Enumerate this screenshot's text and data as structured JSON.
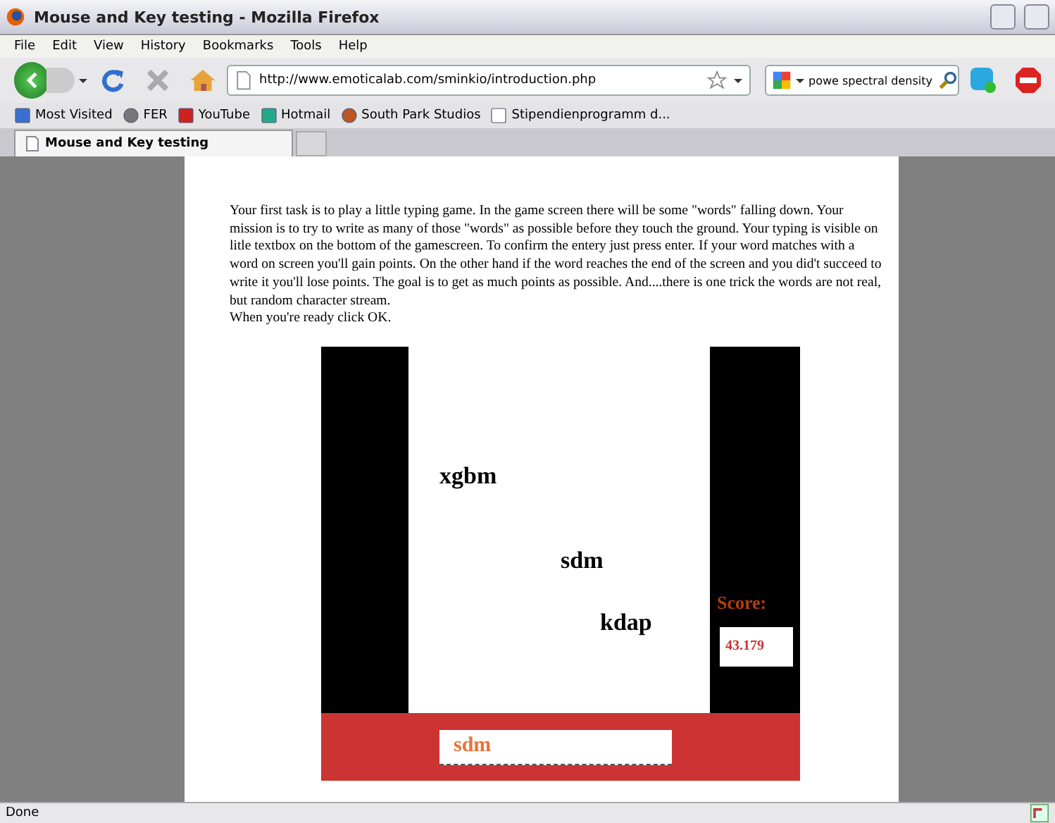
{
  "window": {
    "title": "Mouse and Key testing - Mozilla Firefox"
  },
  "menu": [
    "File",
    "Edit",
    "View",
    "History",
    "Bookmarks",
    "Tools",
    "Help"
  ],
  "navigation": {
    "url": "http://www.emoticalab.com/sminkio/introduction.php",
    "search": "powe spectral density"
  },
  "bookmarks": [
    "Most Visited",
    "FER",
    "YouTube",
    "Hotmail",
    "South Park Studios",
    "Stipendienprogramm d..."
  ],
  "tabs": [
    {
      "label": "Mouse and Key testing",
      "selected": true
    }
  ],
  "page": {
    "instructions": [
      "Your first task is to play a little typing game. In the game screen there will be some \"words\" falling down. Your mission is to try to write as many of those \"words\" as possible before they touch the ground. Your typing is visible on litle textbox on the bottom of the gamescreen. To confirm the entery just press enter. If your word matches with a word on screen you'll gain points. On the other hand if the word reaches the end of the screen and you did't succeed to write it you'll lose points. The goal is to get as much points as possible. And....there is one trick the words are not real, but random character stream.",
      "When you're ready click OK."
    ],
    "game": {
      "falling_words": [
        "xgbm",
        "sdm",
        "kdap"
      ],
      "score_label": "Score:",
      "score": "43.179",
      "input": "sdm"
    }
  },
  "status_bar": {
    "text": "Done"
  }
}
